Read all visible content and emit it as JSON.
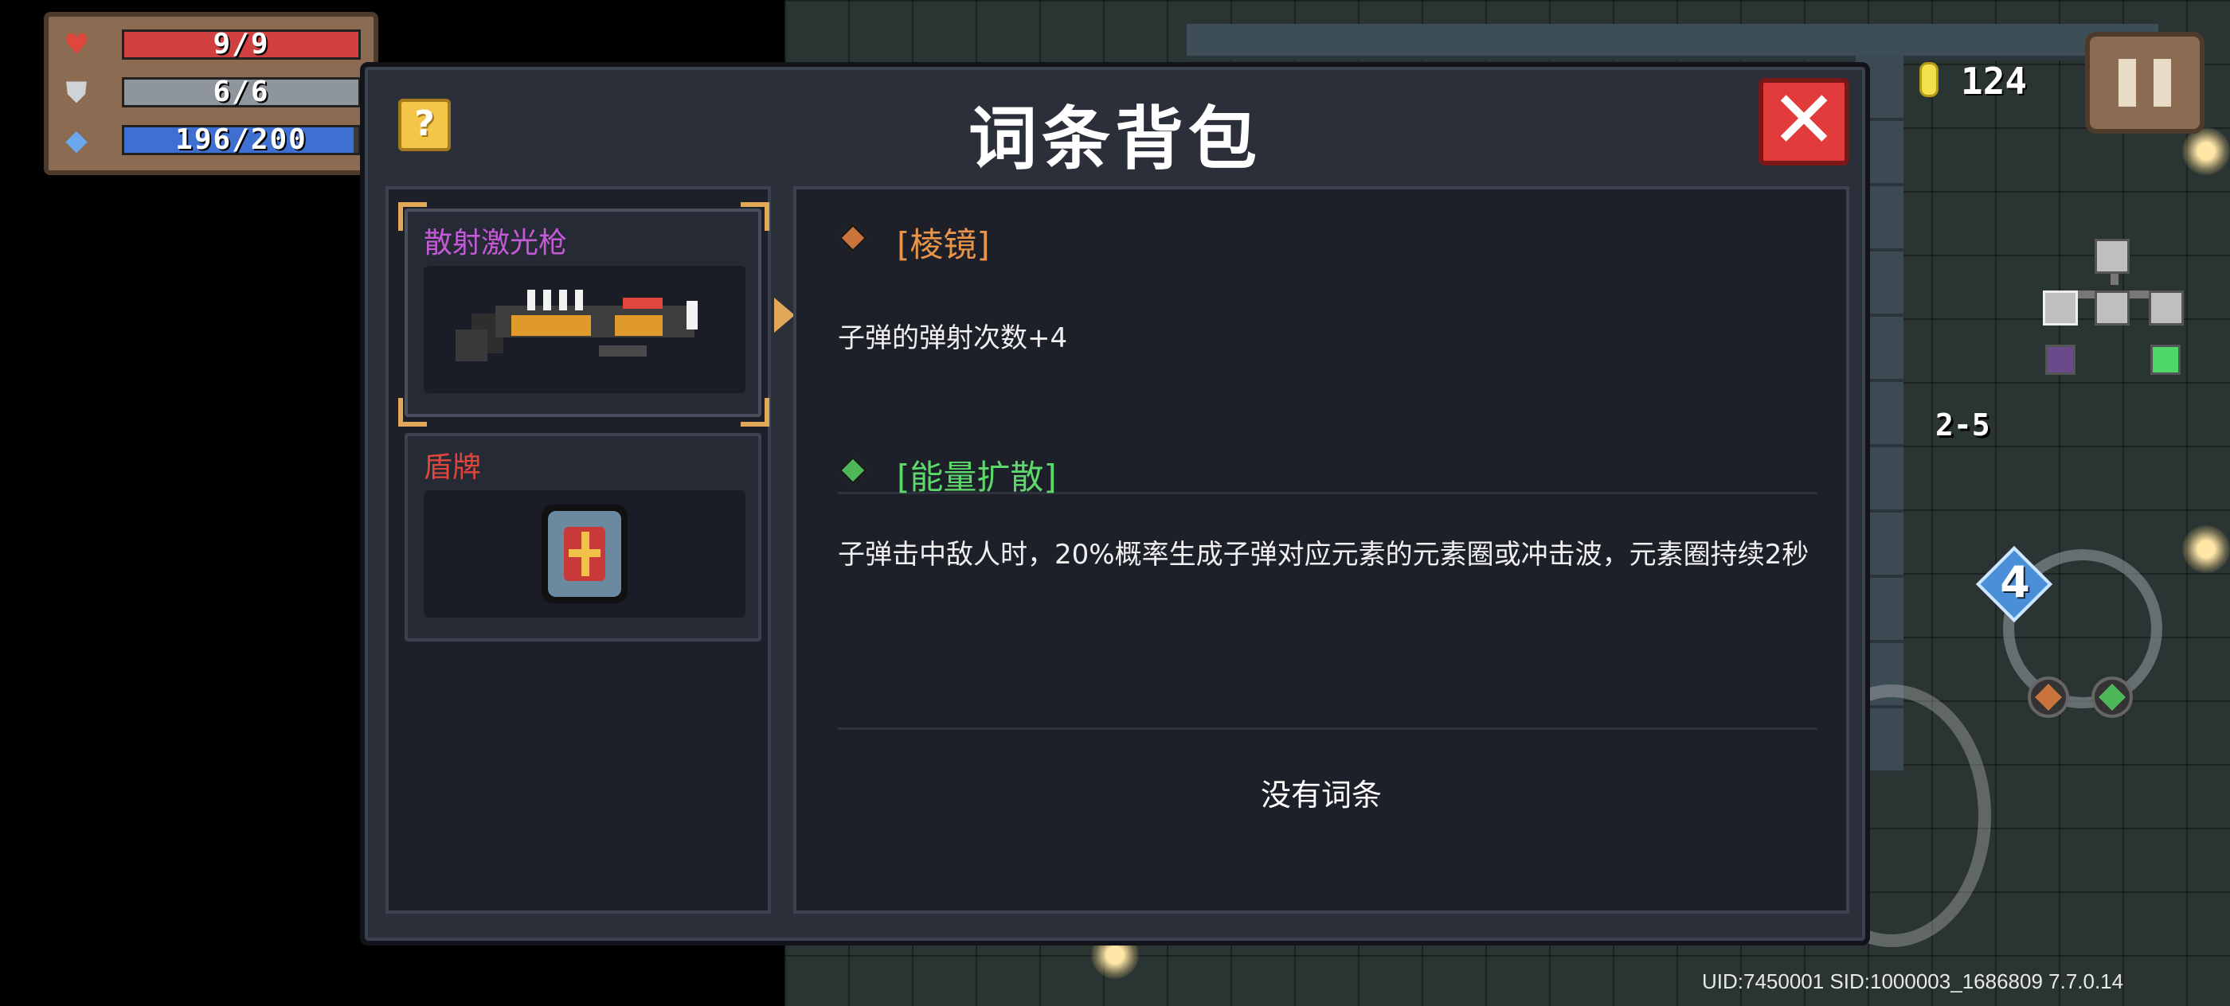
{
  "hud": {
    "health": "9/9",
    "health_fraction": 1.0,
    "armor": "6/6",
    "armor_fraction": 1.0,
    "energy": "196/200",
    "energy_fraction": 0.98,
    "coins": "124",
    "level": "2-5",
    "ammo_cost": "4"
  },
  "dialog": {
    "title": "词条背包",
    "help_label": "?",
    "close_label": "✕"
  },
  "items": [
    {
      "name": "散射激光枪",
      "name_color": "#c45ad8",
      "selected": true
    },
    {
      "name": "盾牌",
      "name_color": "#e0463c",
      "selected": false
    }
  ],
  "affixes": [
    {
      "name": "[棱镜]",
      "color": "#e8944a",
      "gem_color": "#c9743a",
      "description": "子弹的弹射次数+4"
    },
    {
      "name": "[能量扩散]",
      "color": "#5ed86a",
      "gem_color": "#4db85a",
      "description": "子弹击中敌人时，20%概率生成子弹对应元素的元素圈或冲击波，元素圈持续2秒"
    }
  ],
  "empty_slot_text": "没有词条",
  "footer": {
    "uid_line": "UID:7450001 SID:1000003_1686809 7.7.0.14"
  },
  "icons": {
    "health": "heart-icon",
    "armor": "shield-icon",
    "energy": "diamond-icon",
    "coin": "coin-icon",
    "pause": "pause-icon"
  }
}
